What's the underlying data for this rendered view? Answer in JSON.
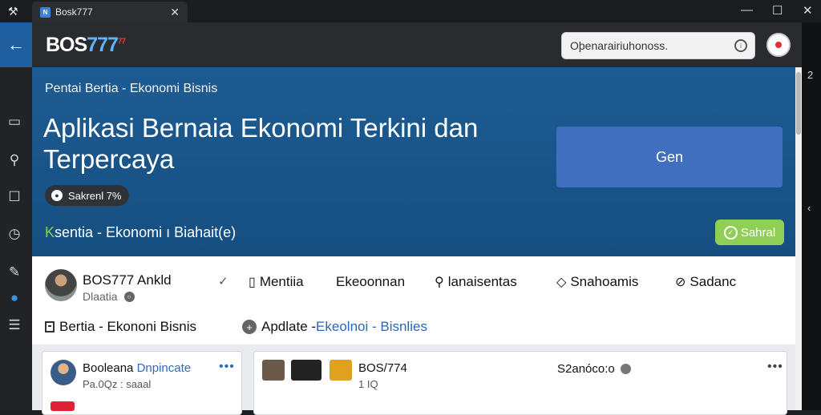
{
  "window": {
    "tab_title": "Bosk777",
    "tab_favicon": "N",
    "controls": {
      "minimize": "—",
      "maximize": "☐",
      "close": "✕"
    }
  },
  "appbar": {
    "brand_part1": "BOS",
    "brand_part2": "777",
    "brand_badge": "77",
    "search_value": "Oþenarairiuhonoss.",
    "search_icon": "i"
  },
  "right_rail": {
    "items": [
      "2",
      "‹"
    ]
  },
  "hero": {
    "breadcrumb": "Pentai Bertia - Ekonomi Bisnis",
    "title": "Aplikasi Bernaia Ekonomi Terkini dan Terpercaya",
    "pill_label": "Sakrenl 7%",
    "subtitle_k": "K",
    "subtitle": "sentia  -  Ekonomi ı Biahait(e)",
    "cta_label": "Gen",
    "save_label": "Sahral",
    "save_icon": "✓"
  },
  "profile": {
    "name": "BOS777 Ankld",
    "sub": "Dlaatia",
    "nav": [
      {
        "label": "Mentiia",
        "icon": "▯"
      },
      {
        "label": "Ekeoonnan",
        "icon": ""
      },
      {
        "label": "lanaisentas",
        "icon": "⚲"
      },
      {
        "label": "Snahoamis",
        "icon": "◇"
      },
      {
        "label": "Sadanc",
        "icon": "⊘"
      }
    ],
    "row2_left": "Bertia - Ekononi Bisnis",
    "row2_right_a": "Apdlate - ",
    "row2_right_b": "Ekeolnoi - Bisnlies"
  },
  "cards": [
    {
      "title": "Booleana ",
      "title_blue": "Dnpincate",
      "meta": "Pa.0Qz  :  saaal",
      "dots": "•••"
    },
    {
      "title": "BOS/774",
      "meta": "1 IQ",
      "right": "S2anóco:o",
      "dots": "•••"
    }
  ],
  "colors": {
    "hero": "#1d5c93",
    "cta": "#3f6fbe",
    "save": "#8fcf55",
    "accent_blue": "#2a6bc4"
  }
}
